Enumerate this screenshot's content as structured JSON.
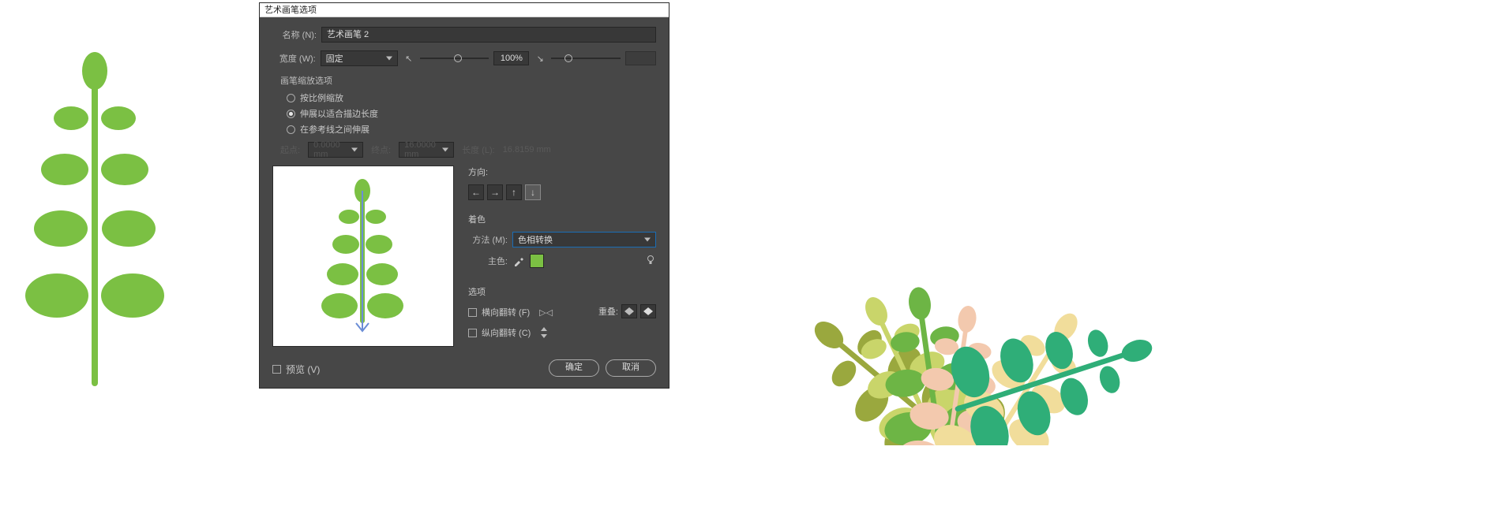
{
  "plant_color": "#7bc043",
  "dialog": {
    "title": "艺术画笔选项",
    "name_label": "名称 (N):",
    "name_value": "艺术画笔 2",
    "width_label": "宽度 (W):",
    "width_mode": "固定",
    "width_value": "100%",
    "scale_section": "画笔缩放选项",
    "scale_options": {
      "proportional": "按比例缩放",
      "stretch": "伸展以适合描边长度",
      "guides": "在参考线之间伸展"
    },
    "disabled_start_label": "起点:",
    "disabled_start_value": "0.0000 mm",
    "disabled_end_label": "终点:",
    "disabled_end_value": "16.0000 mm",
    "disabled_length_label": "长度 (L):",
    "disabled_length_value": "16.8159 mm",
    "direction_label": "方向:",
    "colorization_label": "着色",
    "method_label": "方法 (M):",
    "method_value": "色相转换",
    "key_color_label": "主色:",
    "options_label": "选项",
    "flip_x": "横向翻转 (F)",
    "flip_y": "纵向翻转 (C)",
    "overlap_label": "重叠:",
    "preview_label": "预览 (V)",
    "ok": "确定",
    "cancel": "取消"
  },
  "bouquet_colors": {
    "green": "#6db545",
    "lime": "#c9d56a",
    "olive": "#9aa83e",
    "peach": "#f3c9ae",
    "cream": "#f1dd9b",
    "teal": "#2fae78"
  }
}
